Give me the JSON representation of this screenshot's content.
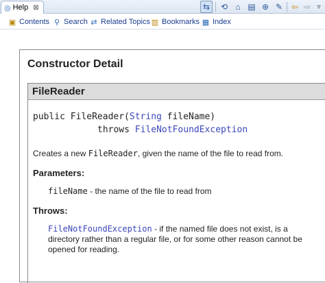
{
  "tab": {
    "title": "Help",
    "icon": "help-icon",
    "close_glyph": "⊠"
  },
  "toolbar": {
    "icons": [
      "show-in-contents-icon",
      "link-with-contents-icon",
      "home-icon",
      "print-icon",
      "bookmark-add-icon",
      "highlight-icon",
      "back-icon",
      "forward-icon",
      "view-menu-icon",
      "minimize-icon"
    ]
  },
  "nav": {
    "contents": "Contents",
    "search": "Search",
    "related_topics": "Related Topics",
    "bookmarks": "Bookmarks",
    "index": "Index"
  },
  "doc": {
    "section_title": "Constructor Detail",
    "member_name": "FileReader",
    "sig_prefix": "public FileReader(",
    "sig_type": "String",
    "sig_suffix": " fileName)",
    "throws_kw": "throws ",
    "throws_type": "FileNotFoundException",
    "desc_prefix": "Creates a new ",
    "desc_code": "FileReader",
    "desc_suffix": ", given the name of the file to read from.",
    "parameters_label": "Parameters:",
    "param_name": "fileName",
    "param_desc": " - the name of the file to read from",
    "throws_label": "Throws:",
    "throws_exception": "FileNotFoundException",
    "throws_desc": " - if the named file does not exist, is a directory rather than a regular file, or for some other reason cannot be opened for reading."
  },
  "colors": {
    "link": "#3b47b8",
    "header_bg": "#dcdcdc",
    "nav_link": "#1a3c8f"
  }
}
